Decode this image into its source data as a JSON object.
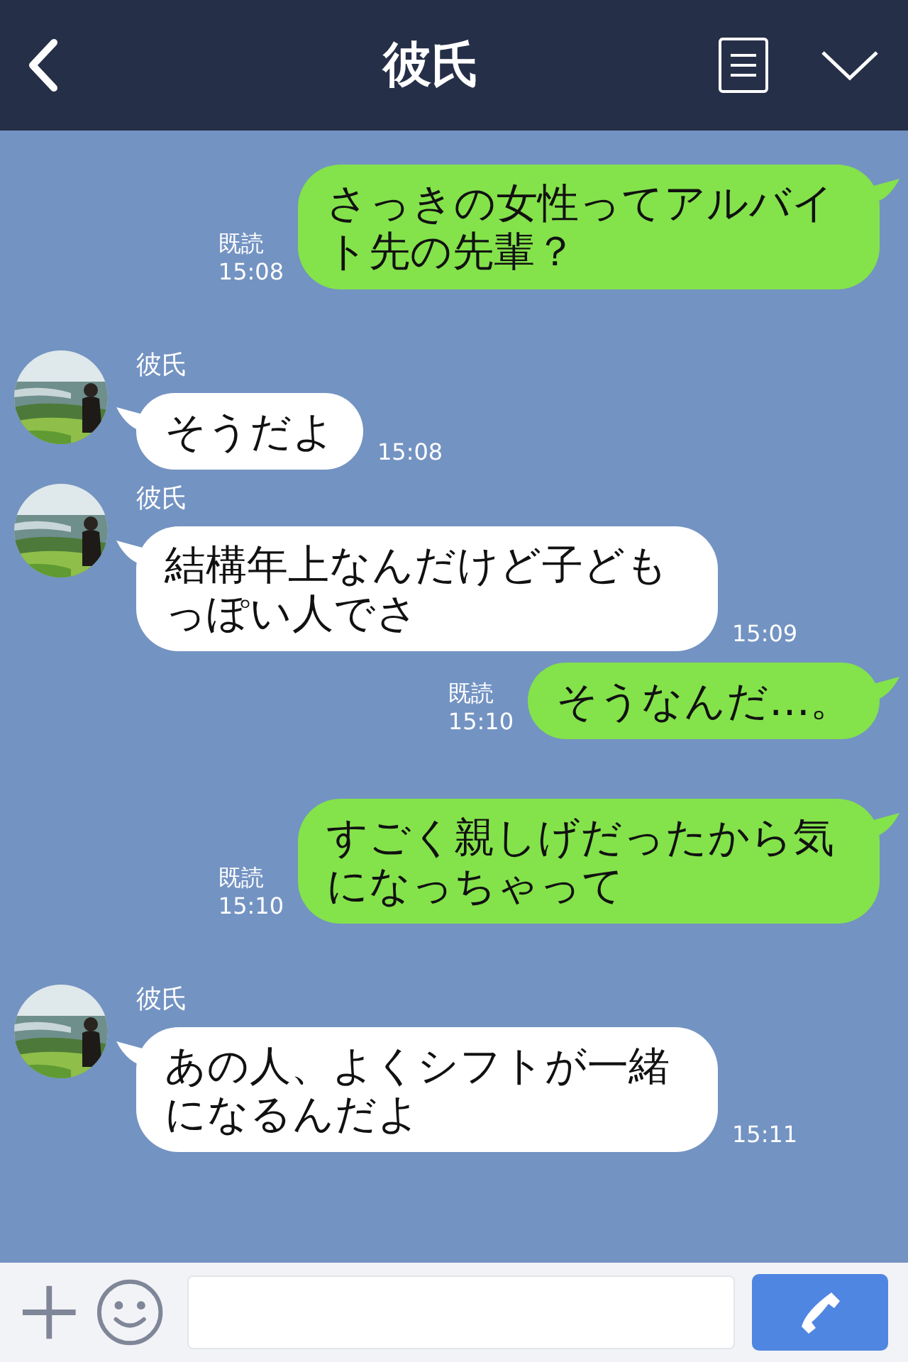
{
  "header": {
    "title": "彼氏"
  },
  "messages": [
    {
      "kind": "sent",
      "text": "さっきの女性ってアルバイト先の先輩？",
      "read": "既読",
      "time": "15:08"
    },
    {
      "kind": "received",
      "sender": "彼氏",
      "text": "そうだよ",
      "time": "15:08"
    },
    {
      "kind": "received",
      "sender": "彼氏",
      "text": "結構年上なんだけど子どもっぽい人でさ",
      "time": "15:09"
    },
    {
      "kind": "sent",
      "text": "そうなんだ…。",
      "read": "既読",
      "time": "15:10"
    },
    {
      "kind": "sent",
      "text": "すごく親しげだったから気になっちゃって",
      "read": "既読",
      "time": "15:10"
    },
    {
      "kind": "received",
      "sender": "彼氏",
      "text": "あの人、よくシフトが一緒になるんだよ",
      "time": "15:11"
    }
  ]
}
